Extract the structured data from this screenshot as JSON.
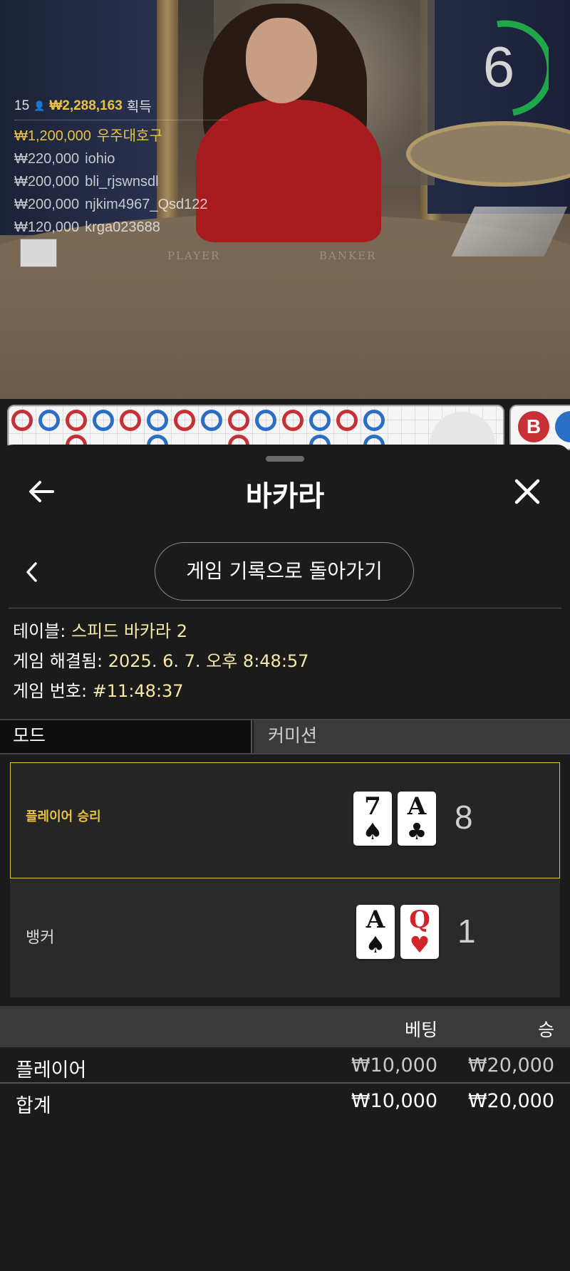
{
  "stream": {
    "winners_header": {
      "count": "15",
      "total": "₩2,288,163",
      "suffix": "획득"
    },
    "winners": [
      {
        "amount": "₩1,200,000",
        "name": "우주대호구"
      },
      {
        "amount": "₩220,000",
        "name": "iohio"
      },
      {
        "amount": "₩200,000",
        "name": "bli_rjswnsdl"
      },
      {
        "amount": "₩200,000",
        "name": "njkim4967_Qsd122"
      },
      {
        "amount": "₩120,000",
        "name": "krga023688"
      }
    ],
    "timer": "6",
    "table_labels": {
      "player": "PLAYER",
      "banker": "BANKER"
    },
    "bead_label": "B"
  },
  "sheet": {
    "title": "바카라",
    "return_label": "게임 기록으로 돌아가기",
    "info": {
      "table_label": "테이블: ",
      "table_value": "스피드 바카라 2",
      "resolved_label": "게임 해결됨: ",
      "resolved_value": "2025. 6. 7. 오후 8:48:57",
      "number_label": "게임 번호: ",
      "number_value": "#11:48:37"
    },
    "tabs": {
      "mode": "모드",
      "commission": "커미션"
    },
    "player": {
      "label": "플레이어 승리",
      "cards": [
        {
          "rank": "7",
          "suit": "♠"
        },
        {
          "rank": "A",
          "suit": "♣"
        }
      ],
      "score": "8"
    },
    "banker": {
      "label": "뱅커",
      "cards": [
        {
          "rank": "A",
          "suit": "♠"
        },
        {
          "rank": "Q",
          "suit": "♥"
        }
      ],
      "score": "1"
    },
    "bets": {
      "headers": {
        "bet": "베팅",
        "win": "승"
      },
      "rows": [
        {
          "name": "플레이어",
          "bet": "₩10,000",
          "win": "₩20,000"
        }
      ],
      "total": {
        "name": "합계",
        "bet": "₩10,000",
        "win": "₩20,000"
      }
    }
  },
  "colors": {
    "accent_gold": "#e8c243",
    "banker_red": "#c73136",
    "player_blue": "#2a6fc5",
    "timer_green": "#1fa84a"
  },
  "icons": [
    "arrow-left-icon",
    "close-icon",
    "chevron-left-icon",
    "person-icon"
  ]
}
